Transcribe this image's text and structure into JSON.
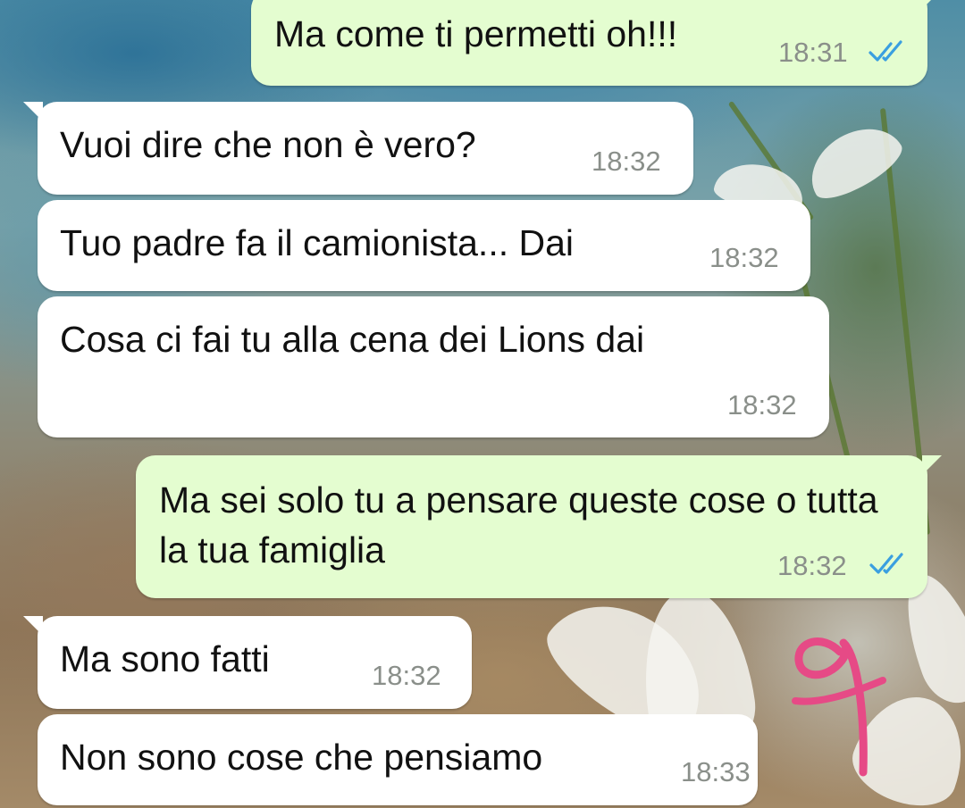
{
  "colors": {
    "incoming_bubble": "#ffffff",
    "outgoing_bubble": "#e4fdd0",
    "text": "#111111",
    "timestamp": "#8a8f8a",
    "read_ticks": "#3a9fe0",
    "scribble": "#e64a86"
  },
  "messages": [
    {
      "direction": "outgoing",
      "text": "Ma come ti permetti oh!!!",
      "time": "18:31",
      "status_icon": "double-check-read-icon"
    },
    {
      "direction": "incoming",
      "text": "Vuoi dire che non è vero?",
      "time": "18:32"
    },
    {
      "direction": "incoming",
      "text": "Tuo padre fa il camionista... Dai",
      "time": "18:32"
    },
    {
      "direction": "incoming",
      "text": "Cosa ci fai tu alla cena dei Lions dai",
      "time": "18:32"
    },
    {
      "direction": "outgoing",
      "text": "Ma sei solo tu a pensare queste cose o tutta la tua famiglia",
      "time": "18:32",
      "status_icon": "double-check-read-icon"
    },
    {
      "direction": "incoming",
      "text": "Ma sono fatti",
      "time": "18:32"
    },
    {
      "direction": "incoming",
      "text": "Non sono cose che pensiamo",
      "time": "18:33"
    }
  ]
}
